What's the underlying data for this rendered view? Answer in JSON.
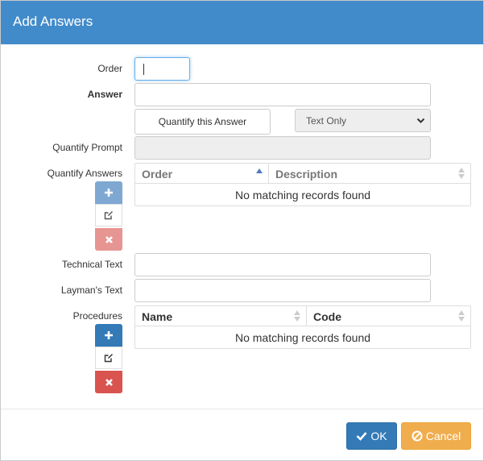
{
  "dialog": {
    "title": "Add Answers"
  },
  "form": {
    "order_label": "Order",
    "answer_label": "Answer",
    "quantify_button": "Quantify this Answer",
    "text_type_selected": "Text Only",
    "quantify_prompt_label": "Quantify Prompt",
    "quantify_answers_label": "Quantify Answers",
    "technical_text_label": "Technical Text",
    "laymans_text_label": "Layman's Text",
    "procedures_label": "Procedures"
  },
  "quantify_table": {
    "columns": [
      "Order",
      "Description"
    ],
    "empty_text": "No matching records found"
  },
  "procedures_table": {
    "columns": [
      "Name",
      "Code"
    ],
    "empty_text": "No matching records found"
  },
  "footer": {
    "ok_label": "OK",
    "cancel_label": "Cancel"
  },
  "colors": {
    "header": "#428bca",
    "primary": "#337ab7",
    "primary_disabled": "#7ea8d2",
    "danger": "#d9534f",
    "danger_disabled": "#e79592",
    "warning": "#f0ad4e"
  },
  "icons": {
    "add": "plus-icon",
    "edit": "edit-icon",
    "remove": "times-icon",
    "ok": "check-icon",
    "cancel": "ban-icon",
    "select": "chevron-down-icon",
    "sort": "sort-icon"
  }
}
